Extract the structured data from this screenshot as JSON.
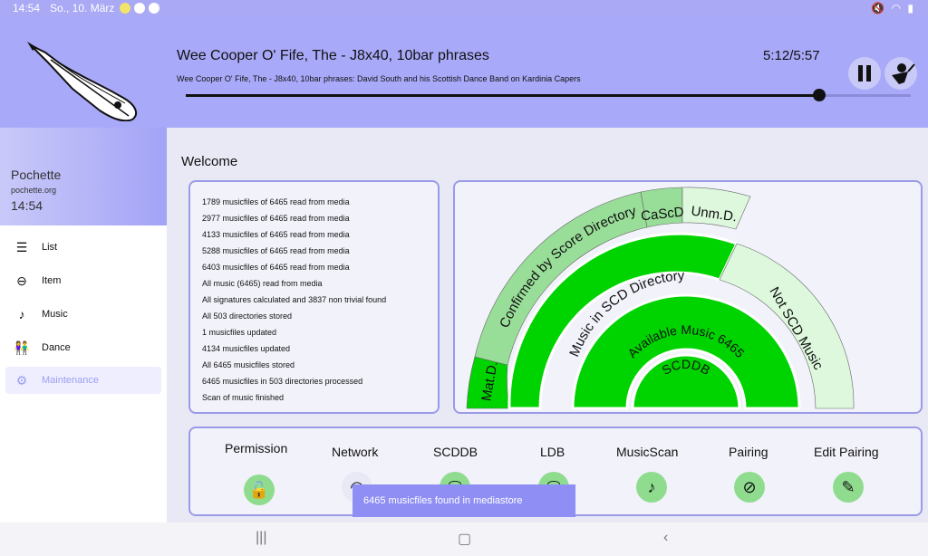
{
  "statusbar": {
    "time": "14:54",
    "date": "So., 10. März"
  },
  "player": {
    "title": "Wee Cooper O' Fife, The - J8x40, 10bar phrases",
    "subtitle": "Wee Cooper O' Fife, The - J8x40, 10bar phrases: David South and his Scottish Dance Band on Kardinia Capers",
    "time": "5:12/5:57",
    "progress": 0.874
  },
  "sidebar": {
    "app_name": "Pochette",
    "app_url": "pochette.org",
    "time": "14:54",
    "items": [
      {
        "label": "List",
        "icon": "list-icon"
      },
      {
        "label": "Item",
        "icon": "item-icon"
      },
      {
        "label": "Music",
        "icon": "music-icon"
      },
      {
        "label": "Dance",
        "icon": "dance-icon"
      },
      {
        "label": "Maintenance",
        "icon": "gear-icon"
      }
    ]
  },
  "main": {
    "welcome": "Welcome",
    "log": [
      "1789 musicfiles of 6465 read from media",
      "2977 musicfiles of 6465 read from media",
      "4133 musicfiles of 6465 read from media",
      "5288 musicfiles of 6465 read from media",
      "6403 musicfiles of 6465 read from media",
      "All music (6465) read from media",
      "All signatures calculated and 3837 non trivial found",
      "All 503 directories stored",
      "1 musicfiles updated",
      "4134 musicfiles updated",
      "All 6465 musicfiles stored",
      "6465 musicfiles in 503 directories processed",
      "Scan of music finished"
    ],
    "sunburst": {
      "center": "SCDDB",
      "ring1": "Available Music 6465",
      "ring2a": "Music in SCD Directory",
      "ring2b": "Not SCD Music",
      "ring3a": "Mat.D.",
      "ring3b": "Confirmed by Score Directory",
      "ring3c": "CaScD",
      "ring3d": "Unm.D.",
      "colors": {
        "strong": "#00d400",
        "mid": "#98dd98",
        "light": "#ddf8dd"
      }
    },
    "tools": [
      {
        "label": "Permission",
        "icon": "unlock-icon"
      },
      {
        "label": "Network",
        "icon": "wifi-icon"
      },
      {
        "label": "SCDDB",
        "icon": "database-icon"
      },
      {
        "label": "LDB",
        "icon": "database-icon"
      },
      {
        "label": "MusicScan",
        "icon": "music-note-icon"
      },
      {
        "label": "Pairing",
        "icon": "paperclip-icon"
      },
      {
        "label": "Edit Pairing",
        "icon": "edit-paperclip-icon"
      }
    ]
  },
  "toast": "6465 musicfiles found in mediastore"
}
